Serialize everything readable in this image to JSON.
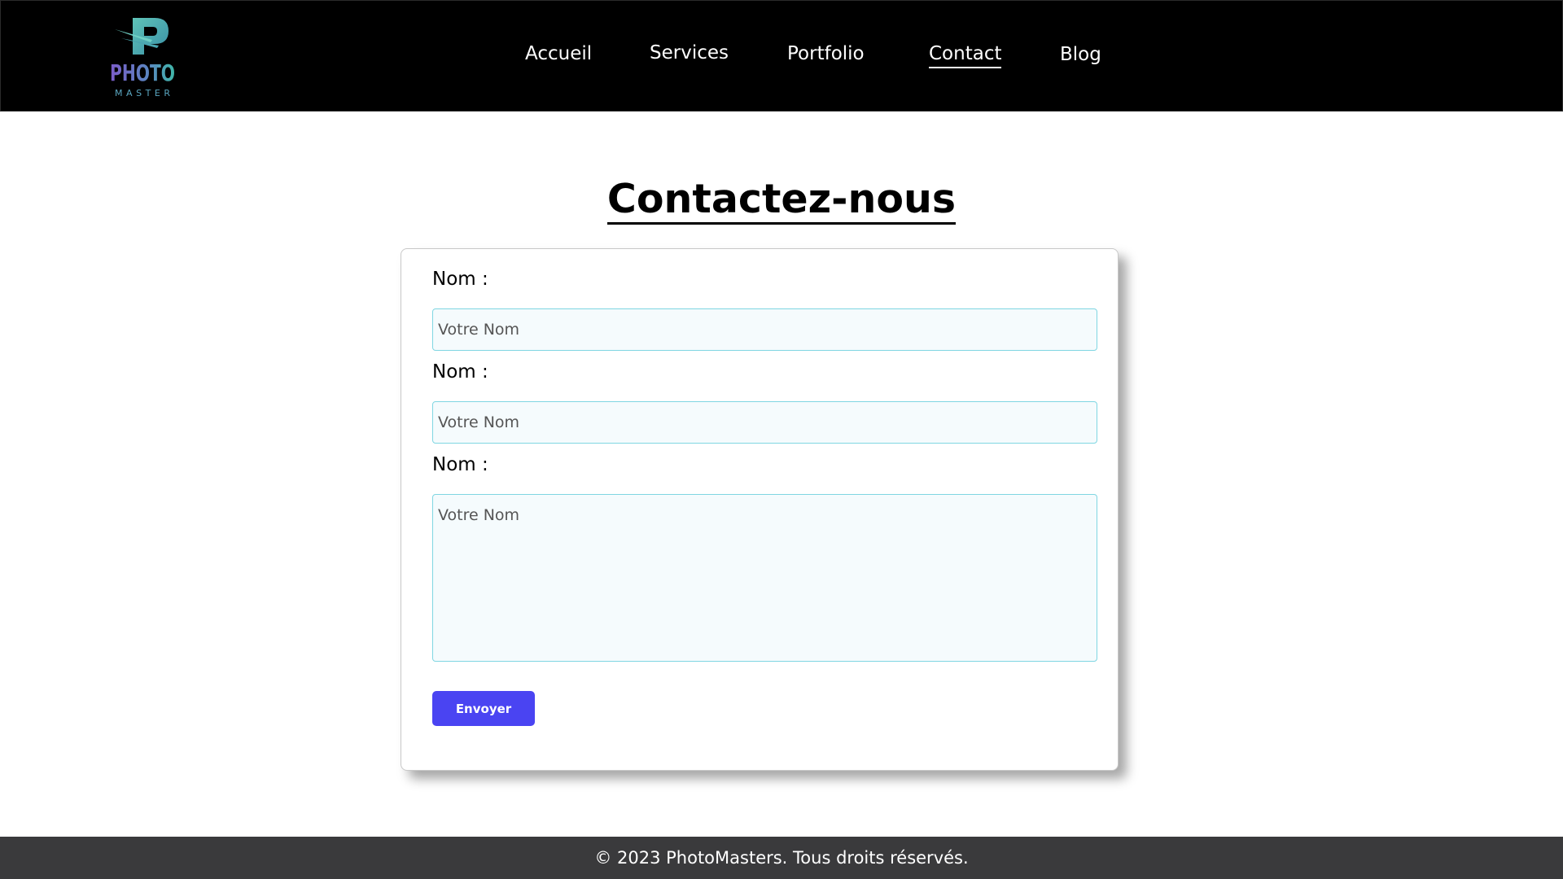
{
  "header": {
    "logo": {
      "wordmark": "PHOTO",
      "subtitle": "MASTER",
      "letter": "P"
    },
    "nav": [
      {
        "label": "Accueil",
        "active": false
      },
      {
        "label": "Services",
        "active": false
      },
      {
        "label": "Portfolio",
        "active": false
      },
      {
        "label": "Contact",
        "active": true
      },
      {
        "label": "Blog",
        "active": false
      }
    ]
  },
  "main": {
    "title": "Contactez-nous",
    "form": {
      "fields": [
        {
          "label": "Nom :",
          "placeholder": "Votre Nom",
          "value": ""
        },
        {
          "label": "Nom :",
          "placeholder": "Votre Nom",
          "value": ""
        },
        {
          "label": "Nom :",
          "placeholder": "Votre Nom",
          "value": ""
        }
      ],
      "submit_label": "Envoyer"
    }
  },
  "footer": {
    "text": "© 2023 PhotoMasters. Tous droits réservés."
  },
  "colors": {
    "header_bg": "#000000",
    "footer_bg": "#3a3a3c",
    "button_bg": "#4a44f2",
    "input_border": "#7fd6e2",
    "input_bg": "#f5fbfd",
    "logo_purple": "#7b5cc9",
    "logo_teal": "#3fb8a8"
  }
}
